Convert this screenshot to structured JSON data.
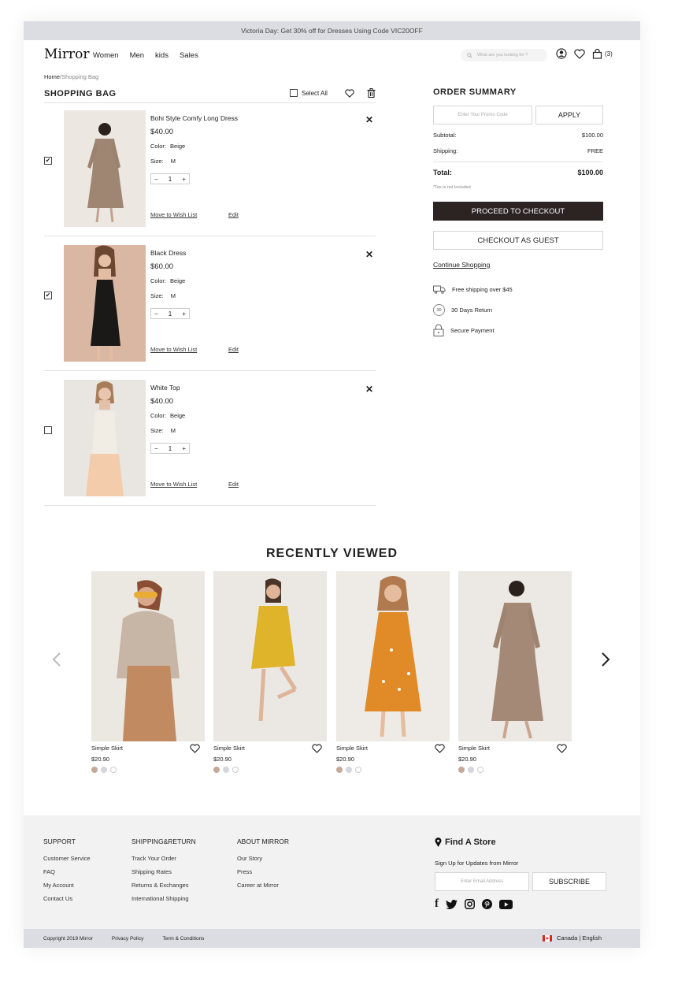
{
  "promo_bar": {
    "text": "Victoria Day: Get 30% off for Dresses Using Code VIC20OFF"
  },
  "header": {
    "logo": "Mirror",
    "nav": [
      "Women",
      "Men",
      "kids",
      "Sales"
    ],
    "search_placeholder": "What are you looking for ?",
    "cart_count": "(3)"
  },
  "breadcrumb": {
    "home": "Home",
    "current": "/Shopping Bag"
  },
  "bag": {
    "title": "SHOPPING BAG",
    "select_all": "Select All",
    "items": [
      {
        "name": "Bohi Style Comfy Long Dress",
        "price": "$40.00",
        "color_label": "Color:",
        "color": "Beige",
        "size_label": "Size:",
        "size": "M",
        "qty": "1",
        "checked": true,
        "wish": "Move to Wish List",
        "edit": "Edit"
      },
      {
        "name": "Black Dress",
        "price": "$60.00",
        "color_label": "Color:",
        "color": "Beige",
        "size_label": "Size:",
        "size": "M",
        "qty": "1",
        "checked": true,
        "wish": "Move to Wish List",
        "edit": "Edit"
      },
      {
        "name": "White Top",
        "price": "$40.00",
        "color_label": "Color:",
        "color": "Beige",
        "size_label": "Size:",
        "size": "M",
        "qty": "1",
        "checked": false,
        "wish": "Move to Wish List",
        "edit": "Edit"
      }
    ]
  },
  "summary": {
    "title": "ORDER SUMMARY",
    "promo_placeholder": "Enter Your Promo Code",
    "apply": "APPLY",
    "subtotal_label": "Subtotal:",
    "subtotal": "$100.00",
    "shipping_label": "Shipping:",
    "shipping": "FREE",
    "total_label": "Total:",
    "total": "$100.00",
    "tax_note": "*Tax is not Included",
    "checkout": "PROCEED TO CHECKOUT",
    "guest": "CHECKOUT AS GUEST",
    "continue": "Continue Shopping",
    "perks": [
      "Free shipping over $45",
      "30 Days Return",
      "Secure Payment"
    ],
    "return_days": "30"
  },
  "recently_viewed": {
    "title": "RECENTLY VIEWED",
    "cards": [
      {
        "name": "Simple Skirt",
        "price": "$20.90"
      },
      {
        "name": "Simple Skirt",
        "price": "$20.90"
      },
      {
        "name": "Simple Skirt",
        "price": "$20.90"
      },
      {
        "name": "Simple Skirt",
        "price": "$20.90"
      }
    ],
    "swatch_colors": [
      "#c4a898",
      "#d4d6dd",
      "#ffffff"
    ]
  },
  "footer": {
    "support": {
      "title": "SUPPORT",
      "links": [
        "Customer Service",
        "FAQ",
        "My Account",
        "Contact Us"
      ]
    },
    "shipping": {
      "title": "SHIPPING&RETURN",
      "links": [
        "Track Your Order",
        "Shipping Rates",
        "Returns & Exchanges",
        "International Shipping"
      ]
    },
    "about": {
      "title": "ABOUT MIRROR",
      "links": [
        "Our Story",
        "Press",
        "Career at Mirror"
      ]
    },
    "find_store": "Find A Store",
    "signup": "Sign Up for Updates from Mirror",
    "email_placeholder": "Enter Email Address",
    "subscribe": "SUBSCRIBE"
  },
  "bottom_bar": {
    "copyright": "Copyright 2019 Mirror",
    "privacy": "Privacy Policy",
    "terms": "Term & Conditions",
    "locale": "Canada | English"
  },
  "colors": {
    "checkout_bg": "#2b2422",
    "bar_bg": "#dcdde2",
    "footer_bg": "#f2f2f3"
  }
}
